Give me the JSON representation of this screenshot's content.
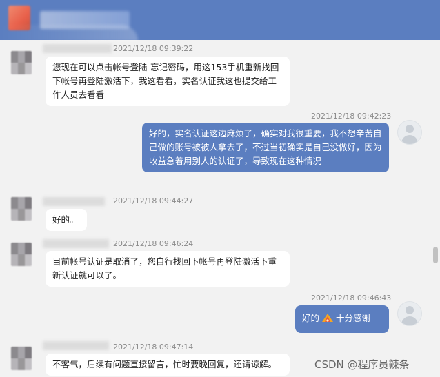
{
  "messages": [
    {
      "side": "left",
      "timestamp": "2021/12/18 09:39:22",
      "text": "您现在可以点击帐号登陆-忘记密码，用这153手机重新找回下帐号再登陆激活下，我这看看，实名认证我这也提交给工作人员去看看"
    },
    {
      "side": "right",
      "timestamp": "2021/12/18 09:42:23",
      "text": "好的，实名认证这边麻烦了，确实对我很重要，我不想辛苦自己做的账号被被人拿去了，不过当初确实是自己没做好，因为收益急着用别人的认证了，导致现在这种情况"
    },
    {
      "side": "left",
      "timestamp": "2021/12/18 09:44:27",
      "text": "好的。"
    },
    {
      "side": "left",
      "timestamp": "2021/12/18 09:46:24",
      "text": "目前帐号认证是取消了，您自行找回下帐号再登陆激活下重新认证就可以了。"
    },
    {
      "side": "right",
      "timestamp": "2021/12/18 09:46:43",
      "text_before": "好的",
      "icon": "fire-icon",
      "text_after": "十分感谢"
    },
    {
      "side": "left",
      "timestamp": "2021/12/18 09:47:14",
      "text": "不客气，后续有问题直接留言，忙时要晚回复，还请谅解。"
    }
  ],
  "watermark": "CSDN @程序员辣条",
  "colors": {
    "header": "#5b7ec0",
    "bubble_right": "#5b7ec0",
    "bubble_left": "#ffffff",
    "background": "#f2f2f2"
  }
}
